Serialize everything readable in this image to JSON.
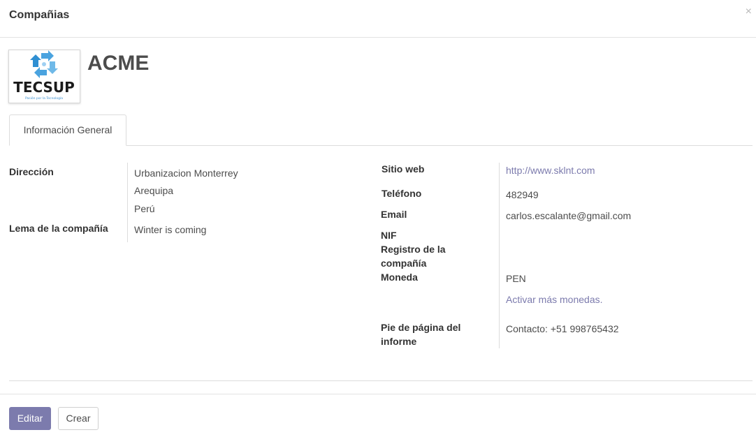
{
  "dialog": {
    "title": "Compañias",
    "close_glyph": "×"
  },
  "company": {
    "name": "ACME",
    "logo": {
      "text": "TECSUP",
      "tagline": "Pasión por la Tecnología",
      "colors": {
        "arrows": "#4aa3df",
        "text": "#1a1a1a",
        "tagline": "#3a8fd0"
      }
    }
  },
  "tabs": [
    {
      "label": "Información General",
      "active": true
    }
  ],
  "left_fields": {
    "address": {
      "label": "Dirección",
      "lines": [
        "Urbanizacion Monterrey",
        "Arequipa",
        "Perú"
      ]
    },
    "slogan": {
      "label": "Lema de la compañía",
      "value": "Winter is coming"
    }
  },
  "right_fields": {
    "website": {
      "label": "Sitio web",
      "value": "http://www.sklnt.com"
    },
    "phone": {
      "label": "Teléfono",
      "value": "482949"
    },
    "email": {
      "label": "Email",
      "value": "carlos.escalante@gmail.com"
    },
    "nif": {
      "label": "NIF",
      "value": ""
    },
    "company_registry": {
      "label_line1": "Registro de la",
      "label_line2": "compañía",
      "value": ""
    },
    "currency": {
      "label": "Moneda",
      "value": "PEN",
      "link": "Activar más monedas."
    },
    "report_footer": {
      "label_line1": "Pie de página del",
      "label_line2": "informe",
      "value": "Contacto: +51 998765432"
    }
  },
  "footer": {
    "edit_label": "Editar",
    "create_label": "Crear"
  },
  "colors": {
    "primary": "#7c7bad",
    "link": "#7c7bad",
    "border": "#dcdcdc"
  }
}
